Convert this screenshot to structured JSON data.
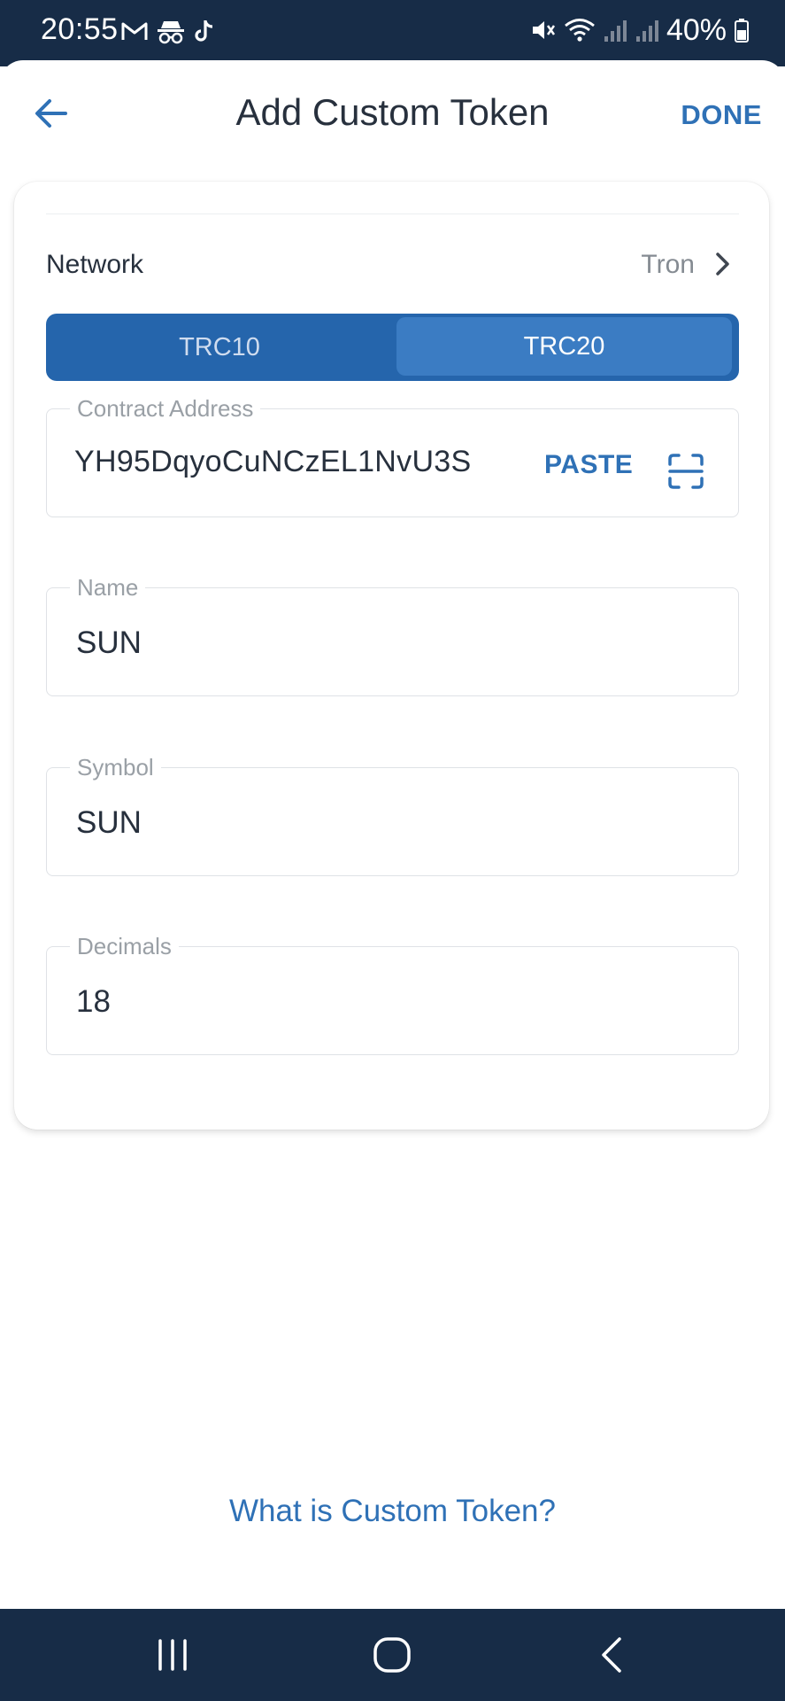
{
  "status_bar": {
    "time": "20:55",
    "battery": "40%",
    "left_icons": [
      "gmail-icon",
      "incognito-icon",
      "tiktok-icon"
    ],
    "right_icons": [
      "mute-icon",
      "wifi-icon",
      "signal-icon",
      "signal-icon",
      "battery-icon"
    ]
  },
  "header": {
    "title": "Add Custom Token",
    "done_label": "DONE",
    "back_icon": "arrow-left-icon"
  },
  "network": {
    "label": "Network",
    "value": "Tron"
  },
  "token_type": {
    "options": [
      "TRC10",
      "TRC20"
    ],
    "selected": "TRC20"
  },
  "fields": {
    "contract_address": {
      "label": "Contract Address",
      "value": "YH95DqyoCuNCzEL1NvU3S",
      "paste_label": "PASTE"
    },
    "name": {
      "label": "Name",
      "value": "SUN"
    },
    "symbol": {
      "label": "Symbol",
      "value": "SUN"
    },
    "decimals": {
      "label": "Decimals",
      "value": "18"
    }
  },
  "help_link": "What is Custom Token?",
  "colors": {
    "accent": "#2f71b6",
    "system_bar": "#172c47",
    "segment_bg": "#2565ac",
    "segment_selected": "#3b7cc3",
    "text_primary": "#27303d",
    "text_secondary": "#9aa0a6"
  }
}
